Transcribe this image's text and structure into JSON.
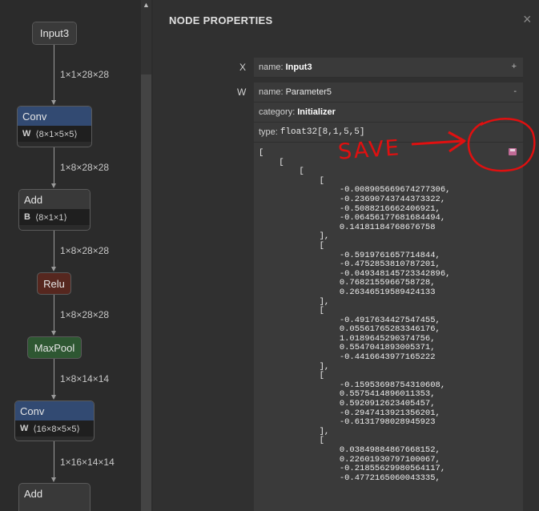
{
  "graph": {
    "nodes": [
      {
        "label": "Input3",
        "color": "#3a3a3a"
      },
      {
        "label": "Conv",
        "color": "#324a72",
        "attr_key": "W",
        "attr_val": "⟨8×1×5×5⟩"
      },
      {
        "label": "Add",
        "color": "#393939",
        "attr_key": "B",
        "attr_val": "⟨8×1×1⟩"
      },
      {
        "label": "Relu",
        "color": "#56271f"
      },
      {
        "label": "MaxPool",
        "color": "#2e5732"
      },
      {
        "label": "Conv",
        "color": "#324a72",
        "attr_key": "W",
        "attr_val": "⟨16×8×5×5⟩"
      },
      {
        "label": "Add",
        "color": "#393939"
      }
    ],
    "edges": [
      "1×1×28×28",
      "1×8×28×28",
      "1×8×28×28",
      "1×8×28×28",
      "1×8×14×14",
      "1×16×14×14"
    ]
  },
  "panel": {
    "title": "NODE PROPERTIES",
    "close": "×",
    "inputs": [
      {
        "label": "X",
        "name_key": "name:",
        "name": "Input3",
        "toggle": "+"
      },
      {
        "label": "W",
        "name_key": "name:",
        "name": "Parameter5",
        "toggle": "-",
        "category_key": "category:",
        "category": "Initializer",
        "type_key": "type:",
        "type": "float32[8,1,5,5]"
      }
    ],
    "tensor_text": "[\n    [\n        [\n            [\n                -0.008905669674277306,\n                -0.23690743744373322,\n                -0.5088216662406921,\n                -0.06456177681684494,\n                0.14181184768676758\n            ],\n            [\n                -0.5919761657714844,\n                -0.4752853810787201,\n                -0.049348145723342896,\n                0.7682155966758728,\n                0.26346519589424133\n            ],\n            [\n                -0.4917634427547455,\n                0.05561765283346176,\n                1.0189645290374756,\n                0.5547041893005371,\n                -0.4416643977165222\n            ],\n            [\n                -0.15953698754310608,\n                0.5575414896011353,\n                0.5920912623405457,\n                -0.2947413921356201,\n                -0.6131798028945923\n            ],\n            [\n                0.03849884867668152,\n                0.22601930797100067,\n                -0.21855629980564117,\n                -0.4772165060043335,"
  },
  "annotation": {
    "text": "SAVE",
    "color": "#e01010"
  },
  "icons": {
    "save": "save-icon",
    "close": "close-icon",
    "scroll_up": "scroll-up-arrow-icon"
  }
}
